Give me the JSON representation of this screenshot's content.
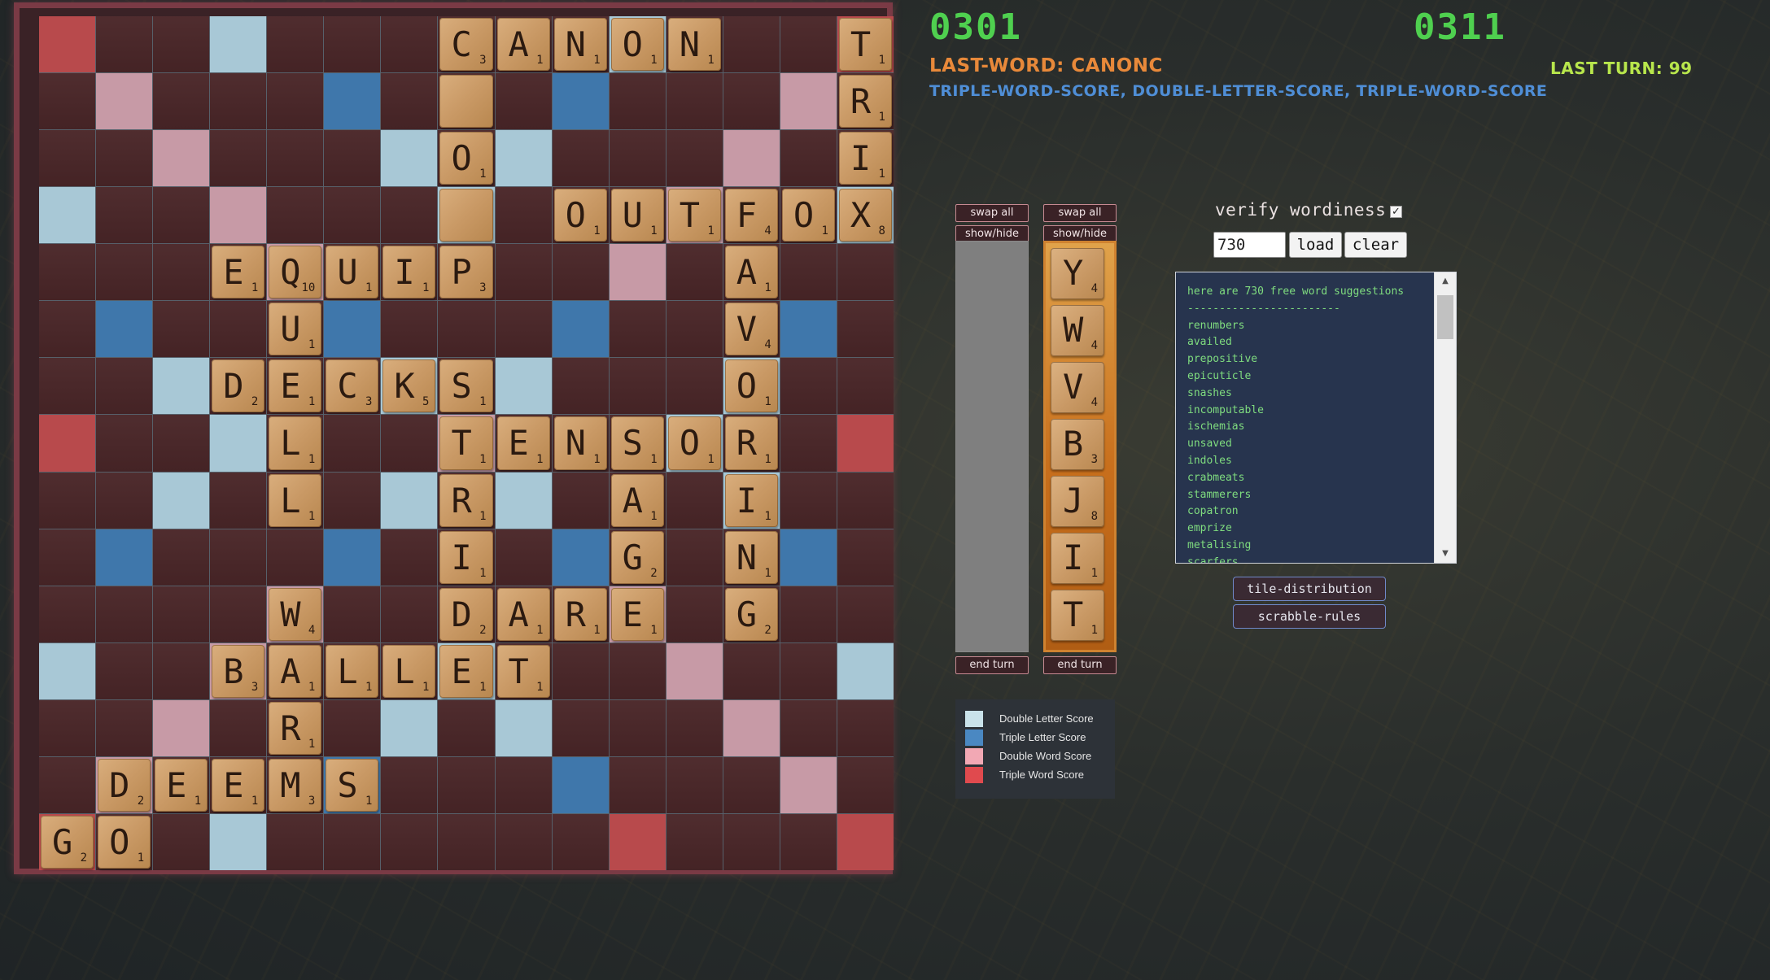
{
  "scores": {
    "left": "0301",
    "right": "0311"
  },
  "last_word": "LAST-WORD: CANONC",
  "last_turn": "LAST TURN: 99",
  "bonus_line": "TRIPLE-WORD-SCORE, DOUBLE-LETTER-SCORE, TRIPLE-WORD-SCORE",
  "colors": {
    "double_letter": "#a8c8d6",
    "triple_letter": "#3f77ab",
    "double_word": "#c79aa6",
    "triple_word": "#b84a4c",
    "score_green": "#4fd04f",
    "last_word_orange": "#e8893a"
  },
  "board": {
    "premium_rows": [
      "t..d......d...t",
      ".w...T...T...w.",
      "..w...d.d...w..",
      "d..w...d...w..d",
      "....w.....w....",
      ".T...T...T...T.",
      "..d...d.d...d..",
      "t..d...w...d..t",
      "..d...d.d...d..",
      ".T...T...T...T.",
      "....w.....w....",
      "d..w...d...w..d",
      "..w...d.d...w..",
      ".w...T...T...w.",
      "t..d......t...t"
    ],
    "tiles": [
      {
        "r": 0,
        "c": 7,
        "l": "C",
        "p": 3
      },
      {
        "r": 0,
        "c": 8,
        "l": "A",
        "p": 1
      },
      {
        "r": 0,
        "c": 9,
        "l": "N",
        "p": 1
      },
      {
        "r": 0,
        "c": 10,
        "l": "O",
        "p": 1
      },
      {
        "r": 0,
        "c": 11,
        "l": "N",
        "p": 1
      },
      {
        "r": 0,
        "c": 14,
        "l": "T",
        "p": 1
      },
      {
        "r": 1,
        "c": 7,
        "l": "",
        "p": ""
      },
      {
        "r": 1,
        "c": 14,
        "l": "R",
        "p": 1
      },
      {
        "r": 2,
        "c": 7,
        "l": "O",
        "p": 1
      },
      {
        "r": 2,
        "c": 14,
        "l": "I",
        "p": 1
      },
      {
        "r": 3,
        "c": 7,
        "l": "",
        "p": ""
      },
      {
        "r": 3,
        "c": 9,
        "l": "O",
        "p": 1
      },
      {
        "r": 3,
        "c": 10,
        "l": "U",
        "p": 1
      },
      {
        "r": 3,
        "c": 11,
        "l": "T",
        "p": 1
      },
      {
        "r": 3,
        "c": 12,
        "l": "F",
        "p": 4
      },
      {
        "r": 3,
        "c": 13,
        "l": "O",
        "p": 1
      },
      {
        "r": 3,
        "c": 14,
        "l": "X",
        "p": 8
      },
      {
        "r": 4,
        "c": 3,
        "l": "E",
        "p": 1
      },
      {
        "r": 4,
        "c": 4,
        "l": "Q",
        "p": 10
      },
      {
        "r": 4,
        "c": 5,
        "l": "U",
        "p": 1
      },
      {
        "r": 4,
        "c": 6,
        "l": "I",
        "p": 1
      },
      {
        "r": 4,
        "c": 7,
        "l": "P",
        "p": 3
      },
      {
        "r": 4,
        "c": 12,
        "l": "A",
        "p": 1
      },
      {
        "r": 5,
        "c": 4,
        "l": "U",
        "p": 1
      },
      {
        "r": 5,
        "c": 12,
        "l": "V",
        "p": 4
      },
      {
        "r": 6,
        "c": 3,
        "l": "D",
        "p": 2
      },
      {
        "r": 6,
        "c": 4,
        "l": "E",
        "p": 1
      },
      {
        "r": 6,
        "c": 5,
        "l": "C",
        "p": 3
      },
      {
        "r": 6,
        "c": 6,
        "l": "K",
        "p": 5
      },
      {
        "r": 6,
        "c": 7,
        "l": "S",
        "p": 1
      },
      {
        "r": 6,
        "c": 12,
        "l": "O",
        "p": 1
      },
      {
        "r": 7,
        "c": 4,
        "l": "L",
        "p": 1
      },
      {
        "r": 7,
        "c": 7,
        "l": "T",
        "p": 1
      },
      {
        "r": 7,
        "c": 8,
        "l": "E",
        "p": 1
      },
      {
        "r": 7,
        "c": 9,
        "l": "N",
        "p": 1
      },
      {
        "r": 7,
        "c": 10,
        "l": "S",
        "p": 1
      },
      {
        "r": 7,
        "c": 11,
        "l": "O",
        "p": 1
      },
      {
        "r": 7,
        "c": 12,
        "l": "R",
        "p": 1
      },
      {
        "r": 8,
        "c": 4,
        "l": "L",
        "p": 1
      },
      {
        "r": 8,
        "c": 7,
        "l": "R",
        "p": 1
      },
      {
        "r": 8,
        "c": 10,
        "l": "A",
        "p": 1
      },
      {
        "r": 8,
        "c": 12,
        "l": "I",
        "p": 1
      },
      {
        "r": 9,
        "c": 7,
        "l": "I",
        "p": 1
      },
      {
        "r": 9,
        "c": 10,
        "l": "G",
        "p": 2
      },
      {
        "r": 9,
        "c": 12,
        "l": "N",
        "p": 1
      },
      {
        "r": 10,
        "c": 4,
        "l": "W",
        "p": 4
      },
      {
        "r": 10,
        "c": 7,
        "l": "D",
        "p": 2
      },
      {
        "r": 10,
        "c": 8,
        "l": "A",
        "p": 1
      },
      {
        "r": 10,
        "c": 9,
        "l": "R",
        "p": 1
      },
      {
        "r": 10,
        "c": 10,
        "l": "E",
        "p": 1
      },
      {
        "r": 10,
        "c": 12,
        "l": "G",
        "p": 2
      },
      {
        "r": 11,
        "c": 3,
        "l": "B",
        "p": 3
      },
      {
        "r": 11,
        "c": 4,
        "l": "A",
        "p": 1
      },
      {
        "r": 11,
        "c": 5,
        "l": "L",
        "p": 1
      },
      {
        "r": 11,
        "c": 6,
        "l": "L",
        "p": 1
      },
      {
        "r": 11,
        "c": 7,
        "l": "E",
        "p": 1
      },
      {
        "r": 11,
        "c": 8,
        "l": "T",
        "p": 1
      },
      {
        "r": 12,
        "c": 4,
        "l": "R",
        "p": 1
      },
      {
        "r": 13,
        "c": 1,
        "l": "D",
        "p": 2
      },
      {
        "r": 13,
        "c": 2,
        "l": "E",
        "p": 1
      },
      {
        "r": 13,
        "c": 3,
        "l": "E",
        "p": 1
      },
      {
        "r": 13,
        "c": 4,
        "l": "M",
        "p": 3
      },
      {
        "r": 13,
        "c": 5,
        "l": "S",
        "p": 1
      },
      {
        "r": 14,
        "c": 0,
        "l": "G",
        "p": 2
      },
      {
        "r": 14,
        "c": 1,
        "l": "O",
        "p": 1
      }
    ]
  },
  "rack_left": {
    "swap_label": "swap all",
    "show_label": "show/hide",
    "end_label": "end turn"
  },
  "rack_right": {
    "swap_label": "swap all",
    "show_label": "show/hide",
    "end_label": "end turn",
    "tiles": [
      {
        "l": "Y",
        "p": 4
      },
      {
        "l": "W",
        "p": 4
      },
      {
        "l": "V",
        "p": 4
      },
      {
        "l": "B",
        "p": 3
      },
      {
        "l": "J",
        "p": 8
      },
      {
        "l": "I",
        "p": 1
      },
      {
        "l": "T",
        "p": 1
      }
    ]
  },
  "legend": [
    {
      "label": "Double Letter Score",
      "color": "#c9e2ea"
    },
    {
      "label": "Triple Letter Score",
      "color": "#4a88c2"
    },
    {
      "label": "Double Word Score",
      "color": "#f2a8b4"
    },
    {
      "label": "Triple Word Score",
      "color": "#e04a4e"
    }
  ],
  "verify": {
    "label": "verify wordiness",
    "checked": true
  },
  "suggestions": {
    "count_value": "730",
    "load_label": "load",
    "clear_label": "clear",
    "header": "here are 730 free word suggestions",
    "divider": "------------------------",
    "words": [
      "renumbers",
      "availed",
      "prepositive",
      "epicuticle",
      "snashes",
      "incomputable",
      "ischemias",
      "unsaved",
      "indoles",
      "crabmeats",
      "stammerers",
      "copatron",
      "emprize",
      "metalising",
      "scarfers"
    ]
  },
  "buttons": {
    "tile_distribution": "tile-distribution",
    "scrabble_rules": "scrabble-rules"
  }
}
